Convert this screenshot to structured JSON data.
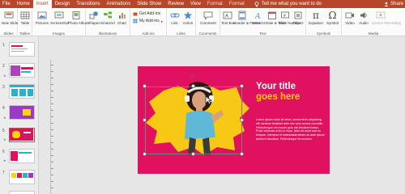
{
  "tabs": [
    "File",
    "Home",
    "Insert",
    "Design",
    "Transitions",
    "Animations",
    "Slide Show",
    "Review",
    "View",
    "Format",
    "Format"
  ],
  "active_tab": "Insert",
  "tell_me": "Tell me what you want to do",
  "share": "Share",
  "ribbon": {
    "slides": {
      "new_slide": "New Slide",
      "group": "Slides"
    },
    "tables": {
      "table": "Table",
      "group": "Tables"
    },
    "images": {
      "pictures": "Pictures",
      "screenshot": "Screenshot",
      "photo_album": "Photo Album",
      "group": "Images"
    },
    "illustrations": {
      "shapes": "Shapes",
      "smartart": "SmartArt",
      "chart": "Chart",
      "group": "Illustrations"
    },
    "addins": {
      "get": "Get Add-ins",
      "my": "My Add-ins",
      "group": "Add-ins"
    },
    "links": {
      "link": "Link",
      "action": "Action",
      "group": "Links"
    },
    "comments": {
      "comment": "Comment",
      "group": "Comments"
    },
    "text": {
      "text_box": "Text Box",
      "header_footer": "Header & Footer",
      "wordart": "WordArt",
      "date_time": "Date & Time",
      "slide_number": "Slide Number",
      "object": "Object",
      "group": "Text"
    },
    "symbols": {
      "equation": "Equation",
      "symbol": "Symbol",
      "group": "Symbols"
    },
    "media": {
      "video": "Video",
      "audio": "Audio",
      "screen_recording": "Screen Recording",
      "group": "Media"
    }
  },
  "thumbnails": [
    "1",
    "2",
    "3",
    "4",
    "5",
    "6",
    "7"
  ],
  "selected_thumbnail": 5,
  "slide": {
    "title_line1": "Your title",
    "title_line2": "goes here",
    "body": "Lorem ipsum dolor sit amet, consectetur adipiscing elit. Aenean tincidunt ante nec sem cursus convallis. Pellentesque vel mauris quis nisl tincidunt luctus. Proin vehicula ut leo in risus. Nam sit amet erat eu tempus. Interdum et malesuada fames ac ante ipsum primis in faucibus. Pellentesque fermentum."
  },
  "colors": {
    "tab_bar": "#b7472a",
    "slide_bg": "#e0115f",
    "accent_yellow": "#ffd400"
  }
}
